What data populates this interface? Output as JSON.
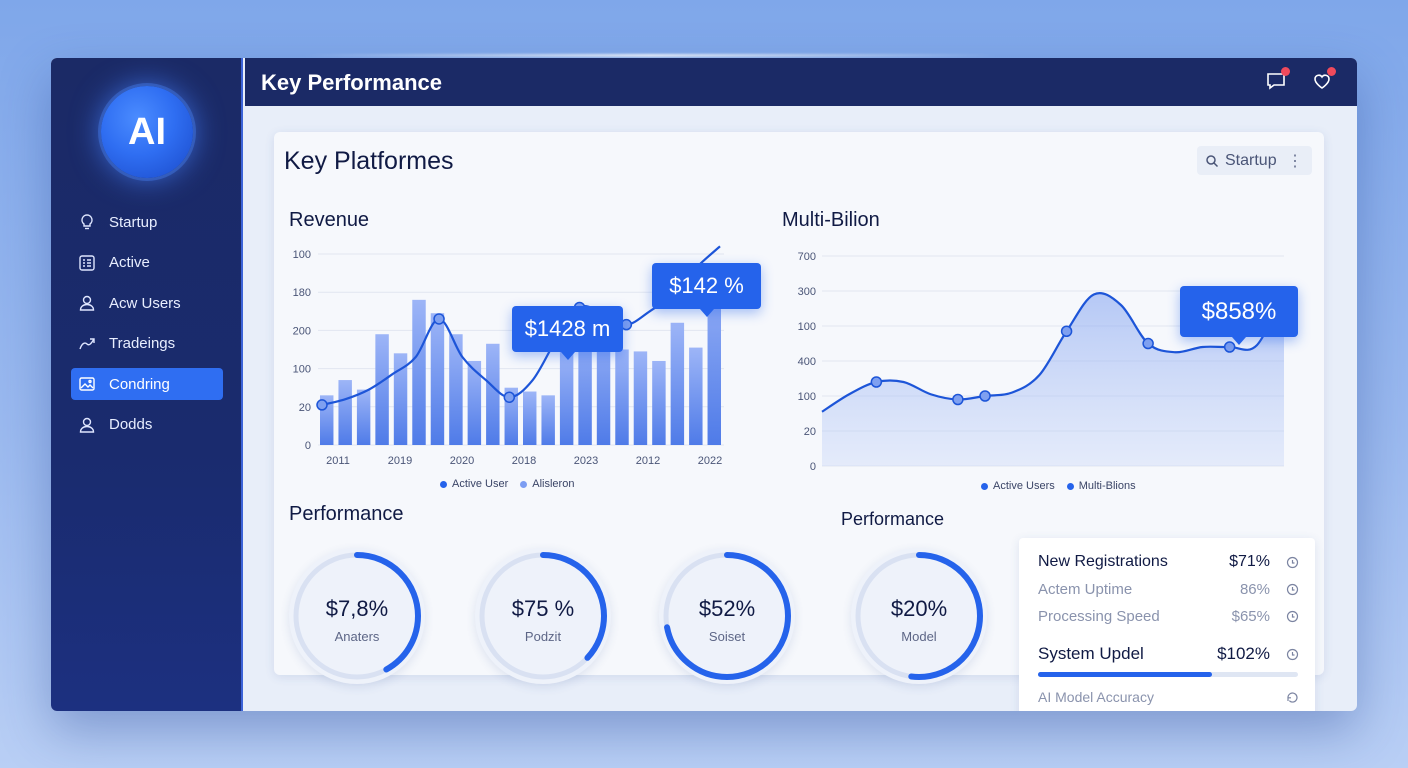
{
  "app": {
    "logo_text": "AI",
    "title": "Key Performance"
  },
  "sidebar": {
    "items": [
      {
        "label": "Startup",
        "icon": "bulb-icon",
        "active": false
      },
      {
        "label": "Active",
        "icon": "list-icon",
        "active": false
      },
      {
        "label": "Acw Users",
        "icon": "user-icon",
        "active": false
      },
      {
        "label": "Tradeings",
        "icon": "trending-icon",
        "active": false
      },
      {
        "label": "Condring",
        "icon": "image-icon",
        "active": true
      },
      {
        "label": "Dodds",
        "icon": "user-icon",
        "active": false
      }
    ]
  },
  "topbar": {
    "icons": [
      "chat-icon",
      "heart-icon"
    ]
  },
  "panel": {
    "title": "Key Platformes",
    "search_label": "Startup",
    "accent": "#2563eb"
  },
  "revenue": {
    "title": "Revenue",
    "callouts": [
      "$1428 m",
      "$142 %"
    ]
  },
  "multi": {
    "title": "Multi-Bilion",
    "callout": "$858%"
  },
  "chart_data": [
    {
      "type": "bar",
      "title": "Revenue",
      "y_tick_labels": [
        "0",
        "20",
        "100",
        "200",
        "180",
        "100"
      ],
      "x_tick_labels": [
        "2011",
        "2019",
        "2020",
        "2018",
        "2023",
        "2012",
        "2022"
      ],
      "legend": [
        "Active User",
        "Alisleron"
      ],
      "ylim": [
        0,
        5
      ],
      "series": [
        {
          "name": "Active User",
          "type": "line",
          "values": [
            1.05,
            1.2,
            1.45,
            1.85,
            2.3,
            3.3,
            2.3,
            1.7,
            1.25,
            1.7,
            2.75,
            3.6,
            3.45,
            3.15,
            3.5,
            3.95,
            4.65,
            5.2
          ]
        },
        {
          "name": "Alisleron",
          "type": "bar",
          "values": [
            1.3,
            1.7,
            1.45,
            2.9,
            2.4,
            3.8,
            3.45,
            2.9,
            2.2,
            2.65,
            1.5,
            1.4,
            1.3,
            2.45,
            3.1,
            3.25,
            2.5,
            2.45,
            2.2,
            3.2,
            2.55,
            4.75
          ]
        }
      ]
    },
    {
      "type": "area",
      "title": "Multi-Bilion",
      "y_tick_labels": [
        "0",
        "20",
        "100",
        "400",
        "100",
        "300",
        "700"
      ],
      "legend": [
        "Active Users",
        "Multi-Blions"
      ],
      "ylim": [
        0,
        6
      ],
      "series": [
        {
          "name": "Active Users",
          "values": [
            1.55,
            2.05,
            2.4,
            2.4,
            2.05,
            1.9,
            2.0,
            2.1,
            2.6,
            3.85,
            4.9,
            4.6,
            3.5,
            3.25,
            3.4,
            3.4,
            3.45,
            5.0
          ]
        }
      ]
    }
  ],
  "performance": {
    "title_left": "Performance",
    "title_right": "Performance",
    "rings": [
      {
        "value": "$7,8%",
        "label": "Anaters",
        "progress": 0.42
      },
      {
        "value": "$75 %",
        "label": "Podzit",
        "progress": 0.37
      },
      {
        "value": "$52%",
        "label": "Soiset",
        "progress": 0.72
      },
      {
        "value": "$20%",
        "label": "Model",
        "progress": 0.52
      }
    ]
  },
  "metrics": {
    "rows": [
      {
        "label": "New Registrations",
        "value": "$71%",
        "emphasis": true
      },
      {
        "label": "Actem Uptime",
        "value": "86%",
        "emphasis": false
      },
      {
        "label": "Processing Speed",
        "value": "$65%",
        "emphasis": false
      },
      {
        "label": "System Updel",
        "value": "$102%",
        "emphasis": true
      },
      {
        "label": "AI Model Accuracy",
        "value": "",
        "emphasis": false
      }
    ],
    "progress": 0.67
  },
  "colors": {
    "sidebar": "#1b2a66",
    "accent": "#2563eb",
    "bar": "#7c9df2",
    "alert": "#ef4a5c"
  }
}
